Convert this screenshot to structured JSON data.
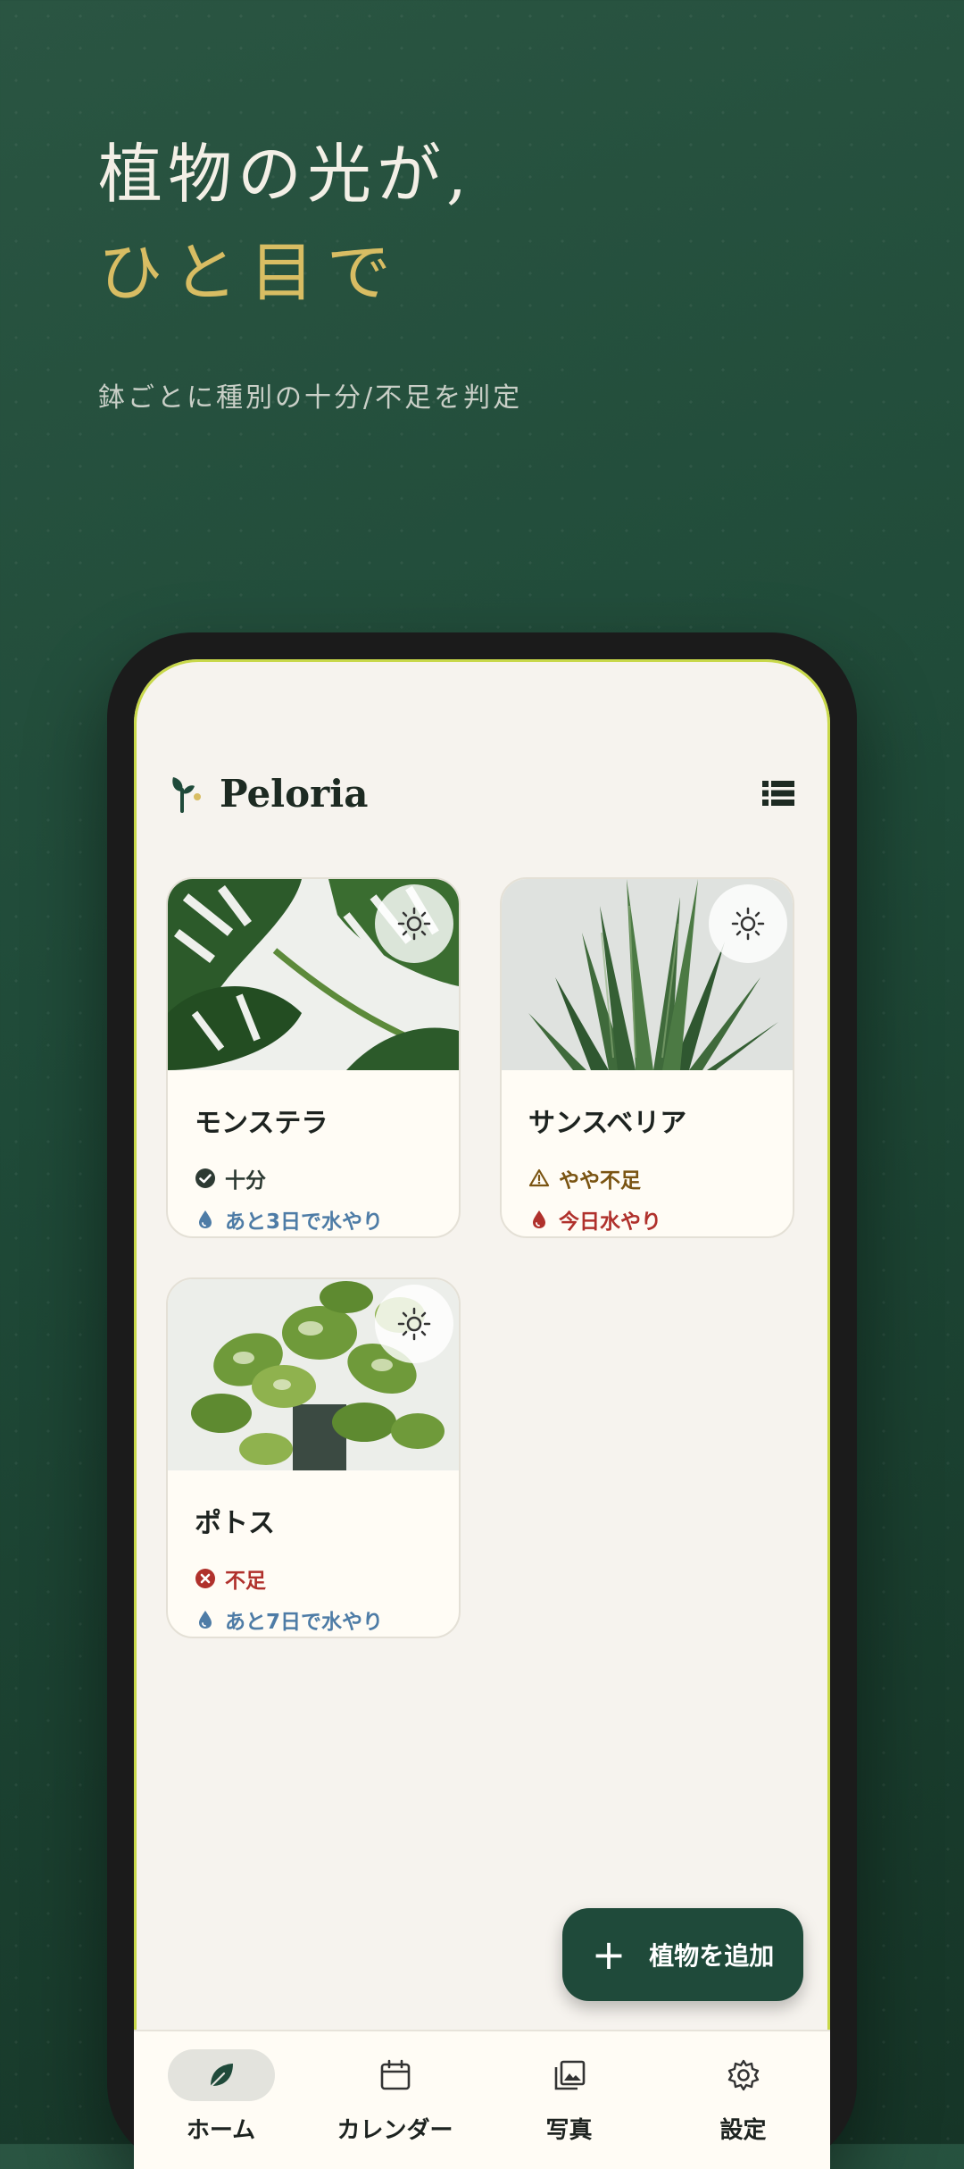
{
  "hero": {
    "title_line1": "植物の光が,",
    "title_line2": "ひと目で",
    "subtitle": "鉢ごとに種別の十分/不足を判定"
  },
  "app": {
    "name": "Peloria"
  },
  "plants": [
    {
      "name": "モンステラ",
      "light_status": "十分",
      "light_level": "ok",
      "water_text": "あと3日で水やり",
      "water_level": "normal"
    },
    {
      "name": "サンスベリア",
      "light_status": "やや不足",
      "light_level": "warn",
      "water_text": "今日水やり",
      "water_level": "urgent"
    },
    {
      "name": "ポトス",
      "light_status": "不足",
      "light_level": "bad",
      "water_text": "あと7日で水やり",
      "water_level": "normal"
    }
  ],
  "fab": {
    "label": "植物を追加"
  },
  "nav": [
    {
      "label": "ホーム",
      "icon": "leaf-icon",
      "active": true
    },
    {
      "label": "カレンダー",
      "icon": "calendar-icon",
      "active": false
    },
    {
      "label": "写真",
      "icon": "photos-icon",
      "active": false
    },
    {
      "label": "設定",
      "icon": "gear-icon",
      "active": false
    }
  ],
  "colors": {
    "background": "#1f4a38",
    "accent_gold": "#d8bd63",
    "primary_green": "#1f4a3a",
    "status_ok": "#2d3a33",
    "status_warn": "#7a5412",
    "status_bad": "#b0312c",
    "water_blue": "#4e7ca6"
  }
}
